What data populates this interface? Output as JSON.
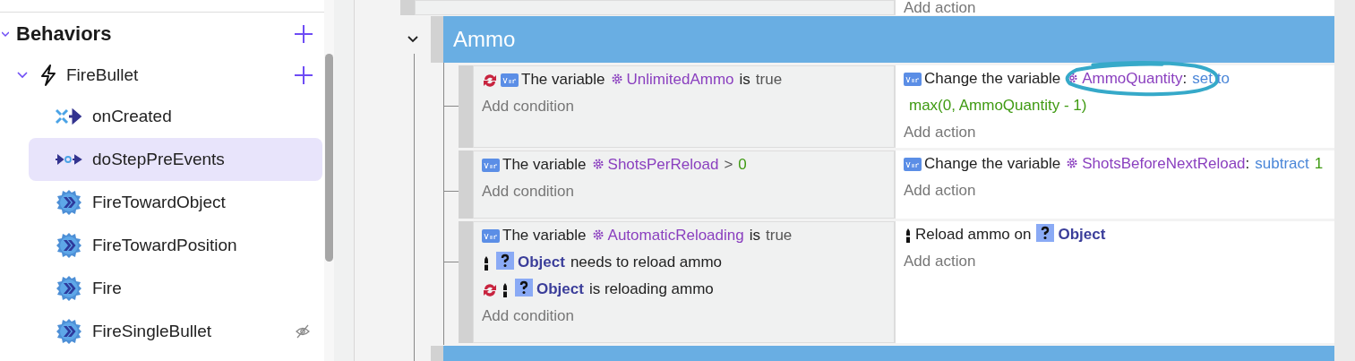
{
  "sidebar": {
    "sections": [
      {
        "title": "Behaviors",
        "expanded": true,
        "items": [
          {
            "name": "FireBullet",
            "expanded": true,
            "children": [
              {
                "name": "onCreated",
                "kind": "created",
                "selected": false,
                "private": false
              },
              {
                "name": "doStepPreEvents",
                "kind": "step",
                "selected": true,
                "private": false
              },
              {
                "name": "FireTowardObject",
                "kind": "function",
                "selected": false,
                "private": false
              },
              {
                "name": "FireTowardPosition",
                "kind": "function",
                "selected": false,
                "private": false
              },
              {
                "name": "Fire",
                "kind": "function",
                "selected": false,
                "private": false
              },
              {
                "name": "FireSingleBullet",
                "kind": "function",
                "selected": false,
                "private": true
              }
            ]
          }
        ]
      }
    ]
  },
  "events": [
    {
      "kind": "event",
      "add_action": "Add action"
    },
    {
      "kind": "group",
      "title": "Ammo",
      "expanded": true,
      "events": [
        {
          "conditions": [
            {
              "inverted": true,
              "kind": "variable",
              "parts": [
                {
                  "text": "The variable",
                  "kind": "text"
                },
                {
                  "text": "UnlimitedAmmo",
                  "kind": "variable"
                },
                {
                  "text": "is",
                  "kind": "text"
                },
                {
                  "text": "true",
                  "kind": "literal"
                }
              ]
            }
          ],
          "add_condition": "Add condition",
          "actions": [
            {
              "kind": "variable",
              "marked": true,
              "parts": [
                {
                  "text": "Change the variable",
                  "kind": "text"
                },
                {
                  "text": "AmmoQuantity",
                  "kind": "variable"
                },
                {
                  "text": ":",
                  "kind": "punct"
                },
                {
                  "text": "set to",
                  "kind": "operation"
                },
                {
                  "text": "max(0, AmmoQuantity - 1)",
                  "kind": "value"
                }
              ]
            }
          ],
          "add_action": "Add action"
        },
        {
          "conditions": [
            {
              "inverted": false,
              "kind": "variable",
              "parts": [
                {
                  "text": "The variable",
                  "kind": "text"
                },
                {
                  "text": "ShotsPerReload",
                  "kind": "variable"
                },
                {
                  "text": ">",
                  "kind": "operator"
                },
                {
                  "text": "0",
                  "kind": "value"
                }
              ]
            }
          ],
          "add_condition": "Add condition",
          "actions": [
            {
              "kind": "variable",
              "marked": false,
              "parts": [
                {
                  "text": "Change the variable",
                  "kind": "text"
                },
                {
                  "text": "ShotsBeforeNextReload",
                  "kind": "variable"
                },
                {
                  "text": ":",
                  "kind": "punct"
                },
                {
                  "text": "subtract",
                  "kind": "operation"
                },
                {
                  "text": "1",
                  "kind": "value"
                }
              ]
            }
          ],
          "add_action": "Add action"
        },
        {
          "conditions": [
            {
              "inverted": false,
              "kind": "variable",
              "parts": [
                {
                  "text": "The variable",
                  "kind": "text"
                },
                {
                  "text": "AutomaticReloading",
                  "kind": "variable"
                },
                {
                  "text": "is",
                  "kind": "text"
                },
                {
                  "text": "true",
                  "kind": "literal"
                }
              ]
            },
            {
              "inverted": false,
              "kind": "bullet",
              "parts": [
                {
                  "text": "Object",
                  "kind": "object"
                },
                {
                  "text": "needs to reload ammo",
                  "kind": "text"
                }
              ]
            },
            {
              "inverted": true,
              "kind": "bullet",
              "parts": [
                {
                  "text": "Object",
                  "kind": "object"
                },
                {
                  "text": "is reloading ammo",
                  "kind": "text"
                }
              ]
            }
          ],
          "add_condition": "Add condition",
          "actions": [
            {
              "kind": "bullet",
              "marked": false,
              "parts": [
                {
                  "text": "Reload ammo on",
                  "kind": "text"
                },
                {
                  "text": "Object",
                  "kind": "object"
                }
              ]
            }
          ],
          "add_action": "Add action"
        }
      ]
    },
    {
      "kind": "group"
    }
  ]
}
